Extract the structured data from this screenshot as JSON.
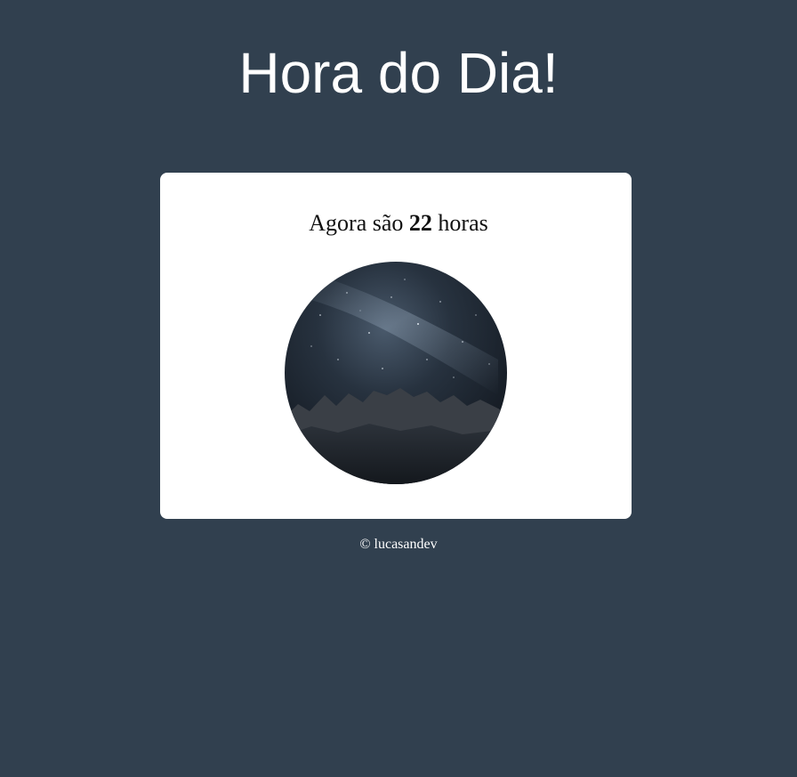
{
  "header": {
    "title": "Hora do Dia!"
  },
  "card": {
    "message_prefix": "Agora são",
    "hour": "22",
    "message_suffix": "horas",
    "image_icon": "night-sky-mountains-image"
  },
  "footer": {
    "copyright": "© lucasandev"
  },
  "colors": {
    "background": "#31404f",
    "card": "#ffffff",
    "title_text": "#ffffff"
  }
}
